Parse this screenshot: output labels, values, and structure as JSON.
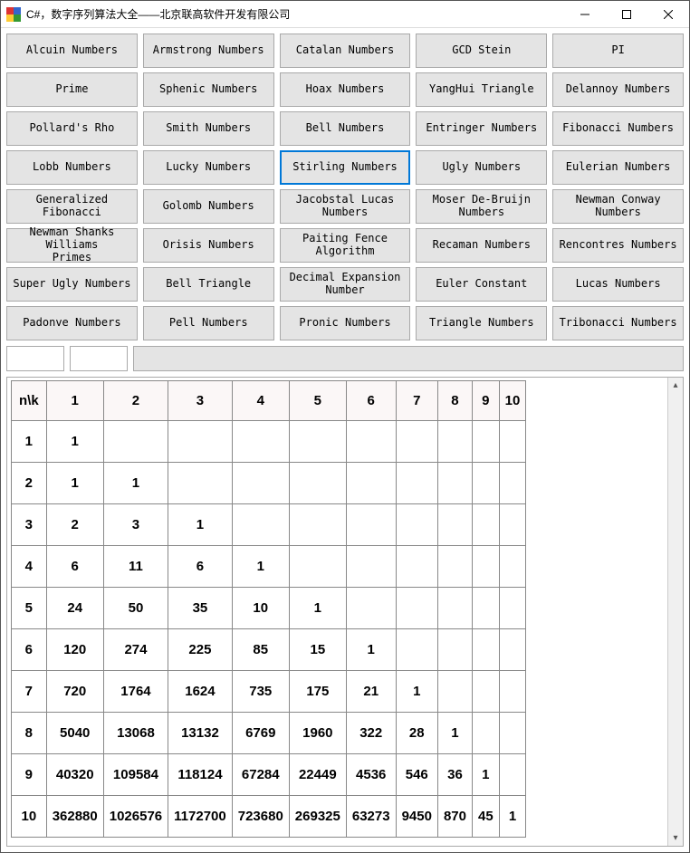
{
  "window": {
    "title": "C#，数字序列算法大全——北京联高软件开发有限公司"
  },
  "buttons": [
    "Alcuin Numbers",
    "Armstrong Numbers",
    "Catalan Numbers",
    "GCD Stein",
    "PI",
    "Prime",
    "Sphenic Numbers",
    "Hoax Numbers",
    "YangHui Triangle",
    "Delannoy Numbers",
    "Pollard's Rho",
    "Smith Numbers",
    "Bell Numbers",
    "Entringer Numbers",
    "Fibonacci Numbers",
    "Lobb Numbers",
    "Lucky Numbers",
    "Stirling Numbers",
    "Ugly Numbers",
    "Eulerian Numbers",
    "Generalized Fibonacci",
    "Golomb Numbers",
    "Jacobstal Lucas\nNumbers",
    "Moser De-Bruijn\nNumbers",
    "Newman Conway Numbers",
    "Newman Shanks Williams\nPrimes",
    "Orisis Numbers",
    "Paiting Fence\nAlgorithm",
    "Recaman Numbers",
    "Rencontres Numbers",
    "Super Ugly Numbers",
    "Bell Triangle",
    "Decimal Expansion\nNumber",
    "Euler Constant",
    "Lucas Numbers",
    "Padonve Numbers",
    "Pell Numbers",
    "Pronic Numbers",
    "Triangle Numbers",
    "Tribonacci Numbers"
  ],
  "selected_button_index": 17,
  "table": {
    "corner": "n\\k",
    "headers": [
      "1",
      "2",
      "3",
      "4",
      "5",
      "6",
      "7",
      "8",
      "9",
      "10"
    ],
    "rows": [
      {
        "n": "1",
        "cells": [
          "1",
          "",
          "",
          "",
          "",
          "",
          "",
          "",
          "",
          ""
        ]
      },
      {
        "n": "2",
        "cells": [
          "1",
          "1",
          "",
          "",
          "",
          "",
          "",
          "",
          "",
          ""
        ]
      },
      {
        "n": "3",
        "cells": [
          "2",
          "3",
          "1",
          "",
          "",
          "",
          "",
          "",
          "",
          ""
        ]
      },
      {
        "n": "4",
        "cells": [
          "6",
          "11",
          "6",
          "1",
          "",
          "",
          "",
          "",
          "",
          ""
        ]
      },
      {
        "n": "5",
        "cells": [
          "24",
          "50",
          "35",
          "10",
          "1",
          "",
          "",
          "",
          "",
          ""
        ]
      },
      {
        "n": "6",
        "cells": [
          "120",
          "274",
          "225",
          "85",
          "15",
          "1",
          "",
          "",
          "",
          ""
        ]
      },
      {
        "n": "7",
        "cells": [
          "720",
          "1764",
          "1624",
          "735",
          "175",
          "21",
          "1",
          "",
          "",
          ""
        ]
      },
      {
        "n": "8",
        "cells": [
          "5040",
          "13068",
          "13132",
          "6769",
          "1960",
          "322",
          "28",
          "1",
          "",
          ""
        ]
      },
      {
        "n": "9",
        "cells": [
          "40320",
          "109584",
          "118124",
          "67284",
          "22449",
          "4536",
          "546",
          "36",
          "1",
          ""
        ]
      },
      {
        "n": "10",
        "cells": [
          "362880",
          "1026576",
          "1172700",
          "723680",
          "269325",
          "63273",
          "9450",
          "870",
          "45",
          "1"
        ]
      }
    ]
  }
}
